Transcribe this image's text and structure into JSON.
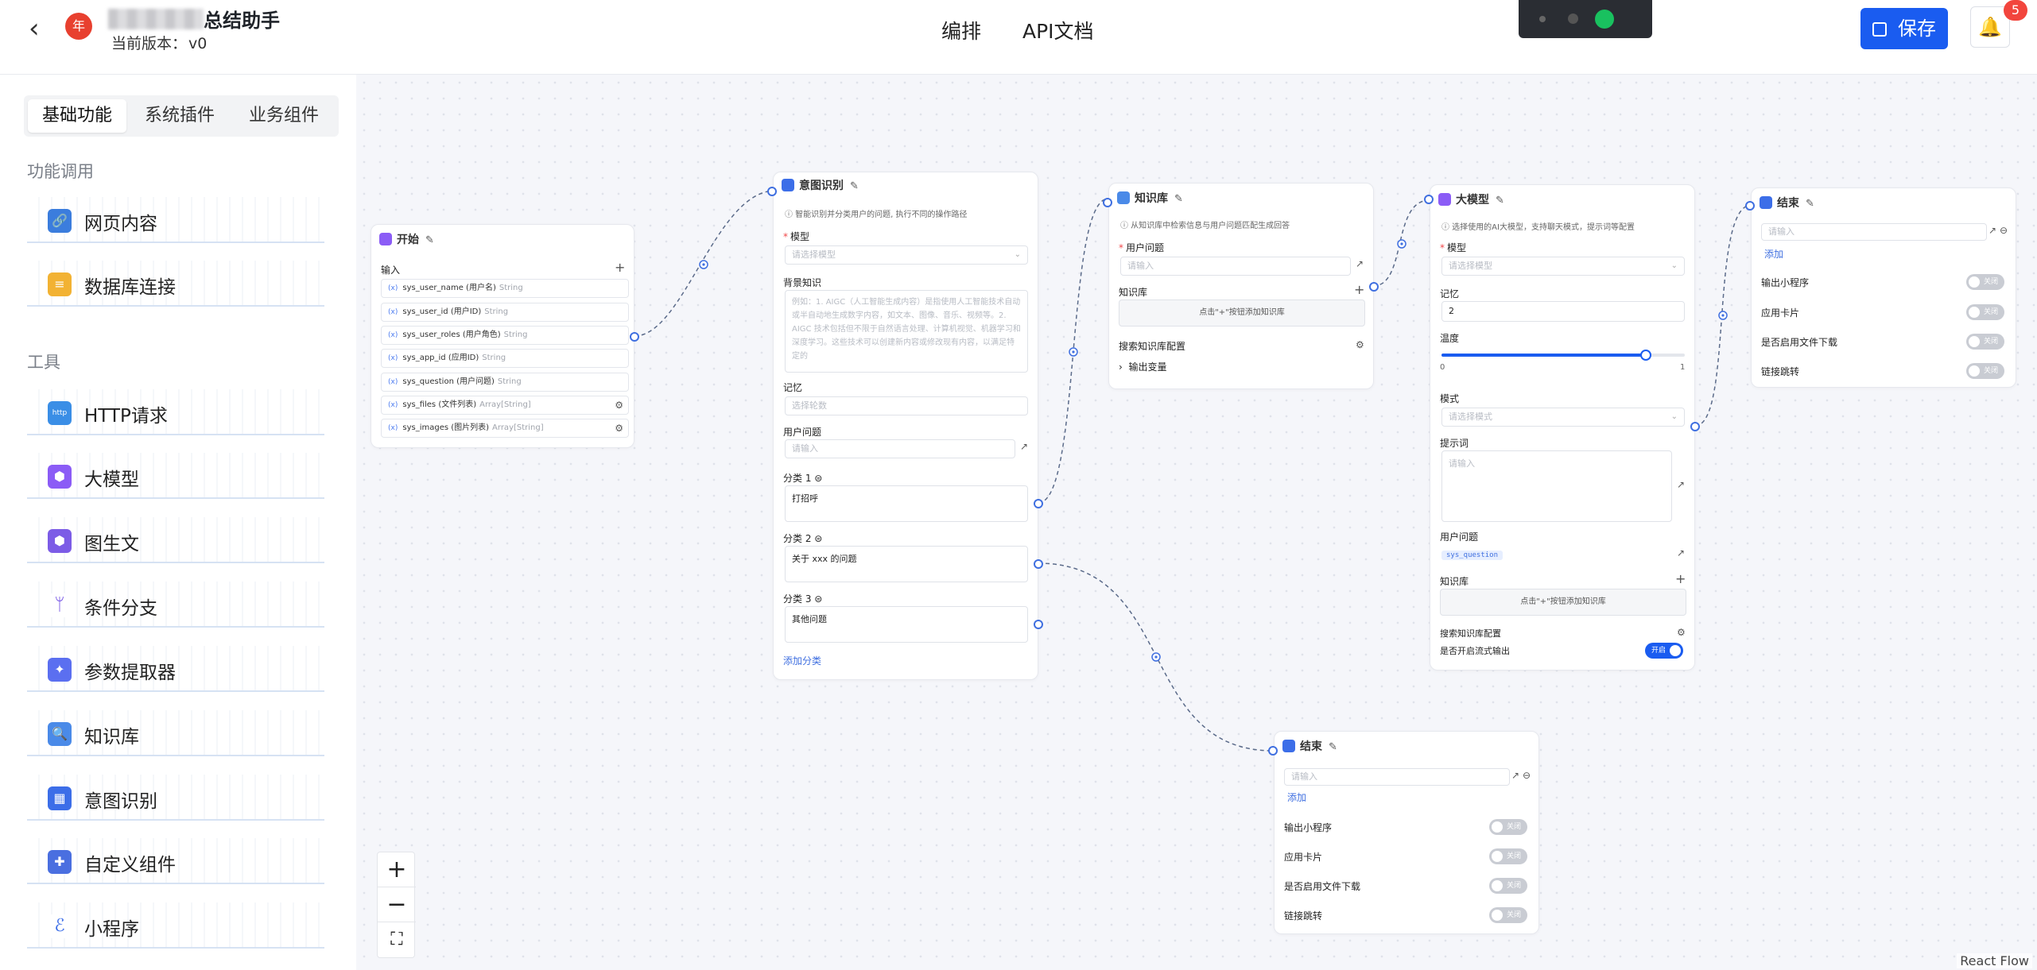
{
  "header": {
    "app_title": "总结助手",
    "version_label": "当前版本：",
    "version_value": "v0",
    "logo_text": "年",
    "tabs": [
      "编排",
      "API文档"
    ],
    "save_label": "保存",
    "notification_count": "5"
  },
  "sidebar": {
    "segments": [
      "基础功能",
      "系统插件",
      "业务组件"
    ],
    "section_function": "功能调用",
    "section_tools": "工具",
    "function_items": [
      "网页内容",
      "数据库连接"
    ],
    "tool_items": [
      "HTTP请求",
      "大模型",
      "图生文",
      "条件分支",
      "参数提取器",
      "知识库",
      "意图识别",
      "自定义组件",
      "小程序"
    ],
    "http_icon_text": "http"
  },
  "canvas": {
    "react_flow_label": "React Flow",
    "controls": [
      "+",
      "−",
      "⛶"
    ]
  },
  "start_node": {
    "title": "开始",
    "input_label": "输入",
    "add": "+",
    "variables": [
      {
        "name": "sys_user_name (用户名)",
        "type": "String"
      },
      {
        "name": "sys_user_id (用户ID)",
        "type": "String"
      },
      {
        "name": "sys_user_roles (用户角色)",
        "type": "String"
      },
      {
        "name": "sys_app_id (应用ID)",
        "type": "String"
      },
      {
        "name": "sys_question (用户问题)",
        "type": "String"
      },
      {
        "name": "sys_files (文件列表)",
        "type": "Array[String]"
      },
      {
        "name": "sys_images (图片列表)",
        "type": "Array[String]"
      }
    ]
  },
  "intent_node": {
    "title": "意图识别",
    "desc": "ⓘ 智能识别并分类用户的问题, 执行不同的操作路径",
    "model_label": "模型",
    "model_placeholder": "请选择模型",
    "bg_label": "背景知识",
    "bg_placeholder": "例如：1. AIGC（人工智能生成内容）是指使用人工智能技术自动或半自动地生成数字内容，如文本、图像、音乐、视频等。2. AIGC 技术包括但不限于自然语言处理、计算机视觉、机器学习和深度学习。这些技术可以创建新内容或修改现有内容，以满足特定的",
    "memory_label": "记忆",
    "memory_placeholder": "选择轮数",
    "question_label": "用户问题",
    "question_placeholder": "请输入",
    "categories": [
      {
        "label": "分类 1",
        "value": "打招呼"
      },
      {
        "label": "分类 2",
        "value": "关于 xxx 的问题"
      },
      {
        "label": "分类 3",
        "value": "其他问题"
      }
    ],
    "add_category": "添加分类"
  },
  "kb_node": {
    "title": "知识库",
    "desc": "ⓘ 从知识库中检索信息与用户问题匹配生成回答",
    "question_label": "用户问题",
    "question_placeholder": "请输入",
    "kb_label": "知识库",
    "kb_hint": "点击\"+\"按钮添加知识库",
    "search_config": "搜索知识库配置",
    "output_vars": "输出变量"
  },
  "llm_node": {
    "title": "大模型",
    "desc": "ⓘ 选择使用的AI大模型，支持聊天模式，提示词等配置",
    "model_label": "模型",
    "model_placeholder": "请选择模型",
    "memory_label": "记忆",
    "memory_value": "2",
    "temp_label": "温度",
    "temp_min": "0",
    "temp_max": "1",
    "temp_value": 0.84,
    "mode_label": "模式",
    "mode_placeholder": "请选择模式",
    "prompt_label": "提示词",
    "prompt_placeholder": "请输入",
    "question_label": "用户问题",
    "question_tag": "sys_question",
    "kb_label": "知识库",
    "kb_hint": "点击\"+\"按钮添加知识库",
    "search_config": "搜索知识库配置",
    "stream_label": "是否开启流式输出",
    "stream_state": "开启"
  },
  "end_node_top": {
    "title": "结束",
    "input_placeholder": "请输入",
    "add": "添加",
    "toggles": [
      {
        "label": "输出小程序",
        "state": "关闭"
      },
      {
        "label": "应用卡片",
        "state": "关闭"
      },
      {
        "label": "是否启用文件下载",
        "state": "关闭"
      },
      {
        "label": "链接跳转",
        "state": "关闭"
      }
    ]
  },
  "end_node_bottom": {
    "title": "结束",
    "input_placeholder": "请输入",
    "add": "添加",
    "toggles": [
      {
        "label": "输出小程序",
        "state": "关闭"
      },
      {
        "label": "应用卡片",
        "state": "关闭"
      },
      {
        "label": "是否启用文件下载",
        "state": "关闭"
      },
      {
        "label": "链接跳转",
        "state": "关闭"
      }
    ]
  },
  "colors": {
    "accent": "#1a5cf0",
    "edge": "#5b6b8a",
    "handle": "#3f6fe0"
  }
}
